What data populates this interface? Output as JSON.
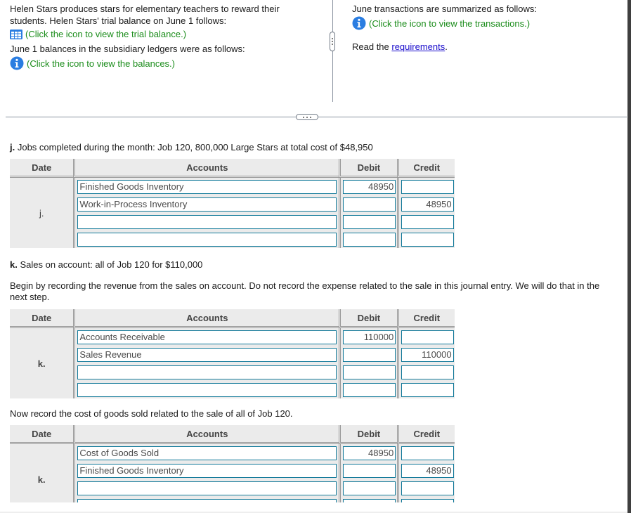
{
  "intro": {
    "left": {
      "paragraph1": "Helen Stars produces stars for elementary teachers to reward their students. Helen Stars' trial balance on June 1 follows:",
      "trial_balance_link": "(Click the icon to view the trial balance.)",
      "paragraph2": "June 1 balances in the subsidiary ledgers were as follows:",
      "balances_link": "(Click the icon to view the balances.)"
    },
    "right": {
      "paragraph1": "June transactions are summarized as follows:",
      "transactions_link": "(Click the icon to view the transactions.)",
      "read_prefix": "Read the ",
      "requirements_link": "requirements",
      "read_suffix": "."
    },
    "icons": {
      "trial_balance": "table-grid-icon",
      "balances": "info-icon",
      "transactions": "info-icon"
    },
    "colors": {
      "link_green": "#1a8c1a",
      "link_blue": "#1a0dcc",
      "icon_blue": "#2a7de1",
      "input_border": "#137a9a"
    }
  },
  "columns": {
    "date": "Date",
    "accounts": "Accounts",
    "debit": "Debit",
    "credit": "Credit"
  },
  "sections": [
    {
      "label": "j.",
      "text": " Jobs completed during the month: Job 120, 800,000 Large Stars at total cost of $48,950",
      "date": "j.",
      "rows": [
        {
          "account": "Finished Goods Inventory",
          "debit": "48950",
          "credit": ""
        },
        {
          "account": "Work-in-Process Inventory",
          "debit": "",
          "credit": "48950"
        },
        {
          "account": "",
          "debit": "",
          "credit": ""
        },
        {
          "account": "",
          "debit": "",
          "credit": ""
        }
      ]
    },
    {
      "label": "k.",
      "text": " Sales on account: all of Job 120 for $110,000",
      "instruction": "Begin by recording the revenue from the sales on account. Do not record the expense related to the sale in this journal entry. We will do that in the next step.",
      "date": "k.",
      "rows": [
        {
          "account": "Accounts Receivable",
          "debit": "110000",
          "credit": ""
        },
        {
          "account": "Sales Revenue",
          "debit": "",
          "credit": "110000"
        },
        {
          "account": "",
          "debit": "",
          "credit": ""
        },
        {
          "account": "",
          "debit": "",
          "credit": ""
        }
      ]
    },
    {
      "instruction": "Now record the cost of goods sold related to the sale of all of Job 120.",
      "date": "k.",
      "rows": [
        {
          "account": "Cost of Goods Sold",
          "debit": "48950",
          "credit": ""
        },
        {
          "account": "Finished Goods Inventory",
          "debit": "",
          "credit": "48950"
        },
        {
          "account": "",
          "debit": "",
          "credit": ""
        },
        {
          "account": "",
          "debit": "",
          "credit": ""
        }
      ]
    }
  ]
}
